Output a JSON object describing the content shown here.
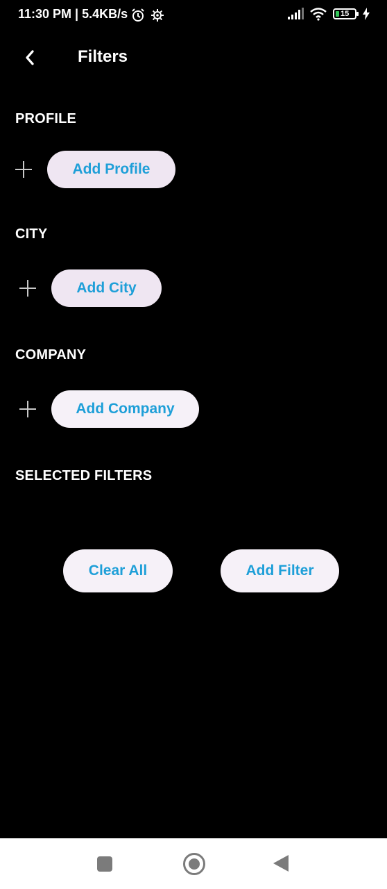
{
  "status_bar": {
    "time_speed": "11:30 PM | 5.4KB/s",
    "battery_level": "15"
  },
  "header": {
    "title": "Filters"
  },
  "sections": {
    "profile": {
      "title": "PROFILE",
      "button_label": "Add Profile"
    },
    "city": {
      "title": "CITY",
      "button_label": "Add City"
    },
    "company": {
      "title": "COMPANY",
      "button_label": "Add Company"
    },
    "selected": {
      "title": "SELECTED FILTERS"
    }
  },
  "actions": {
    "clear_label": "Clear All",
    "add_filter_label": "Add Filter"
  },
  "colors": {
    "background": "#000000",
    "accent": "#1e9fd8",
    "pill_bg": "#efe6f2"
  },
  "icons": [
    "alarm-icon",
    "settings-gear-icon",
    "signal-icon",
    "wifi-icon",
    "battery-icon",
    "charging-icon",
    "back-arrow-icon",
    "plus-icon",
    "nav-recents-icon",
    "nav-home-icon",
    "nav-back-icon"
  ]
}
